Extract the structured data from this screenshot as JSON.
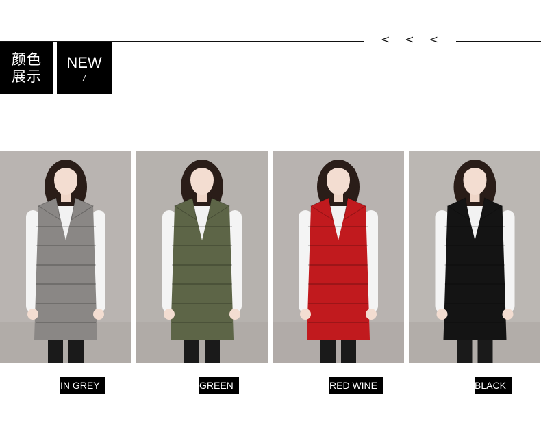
{
  "header": {
    "cn_line1": "颜色",
    "cn_line2": "展示",
    "new_title": "NEW",
    "new_slash": "/",
    "chevrons": [
      "<",
      "<",
      "<"
    ]
  },
  "products": [
    {
      "label": "IN GREY",
      "vest_color": "#8a8785",
      "bg_color": "#b9b4b1"
    },
    {
      "label": "GREEN",
      "vest_color": "#5d6547",
      "bg_color": "#b6b2ae"
    },
    {
      "label": "RED WINE",
      "vest_color": "#c11a1e",
      "bg_color": "#b8b3b0"
    },
    {
      "label": "BLACK",
      "vest_color": "#141414",
      "bg_color": "#bbb7b3"
    }
  ]
}
